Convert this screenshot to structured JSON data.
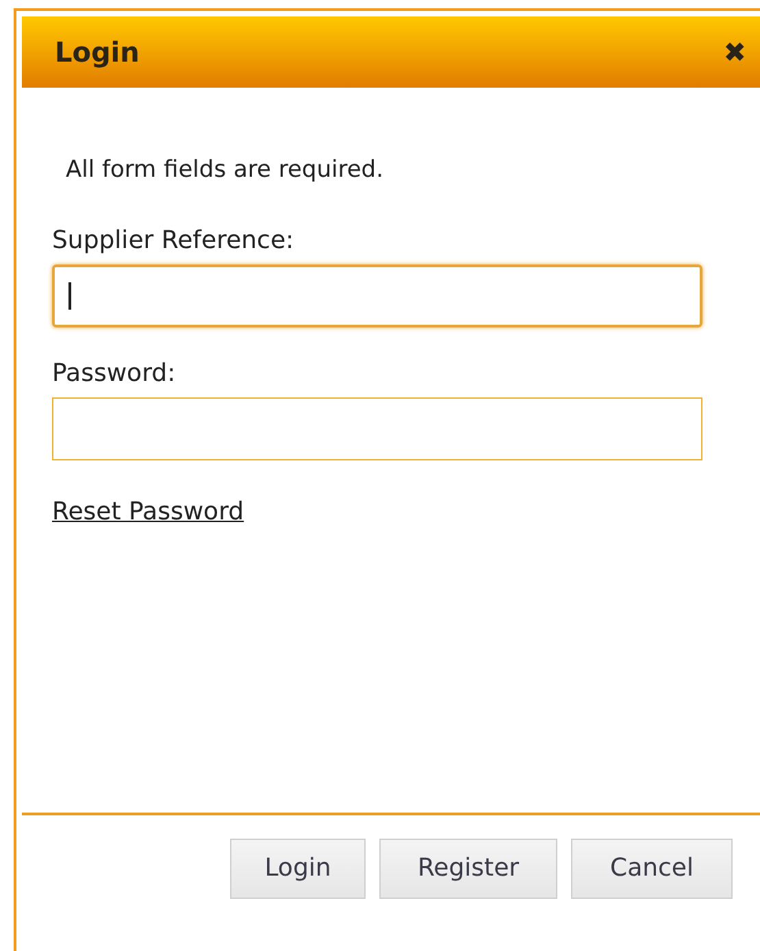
{
  "dialog": {
    "title": "Login",
    "close": "✖"
  },
  "note": "All form fields are required.",
  "fields": [
    {
      "label": "Supplier Reference:",
      "focused": true
    },
    {
      "label": "Password:",
      "focused": false
    }
  ],
  "link": "Reset Password",
  "buttons": [
    "Login",
    "Register",
    "Cancel"
  ]
}
